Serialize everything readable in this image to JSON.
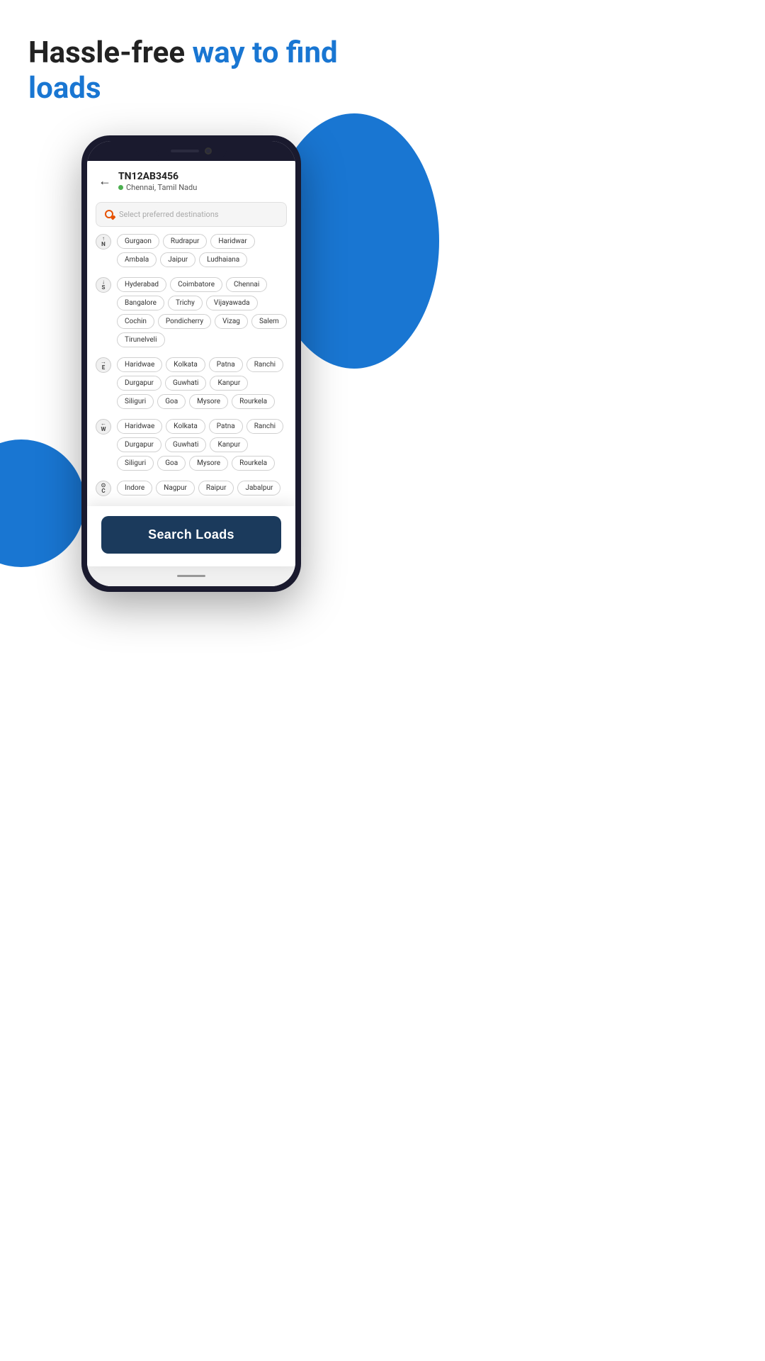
{
  "hero": {
    "line1_black": "Hassle-free ",
    "line1_blue": "way to find",
    "line2_blue": "loads"
  },
  "phone": {
    "truck_id": "TN12AB3456",
    "location": "Chennai, Tamil Nadu",
    "search_placeholder": "Select preferred destinations",
    "directions": [
      {
        "id": "N",
        "label": "N",
        "sublabel": "",
        "tags": [
          "Gurgaon",
          "Rudrapur",
          "Haridwar",
          "Ambala",
          "Jaipur",
          "Ludhaiana"
        ]
      },
      {
        "id": "S",
        "label": "S",
        "sublabel": "",
        "tags": [
          "Hyderabad",
          "Coimbatore",
          "Chennai",
          "Bangalore",
          "Trichy",
          "Vijayawada",
          "Cochin",
          "Pondicherry",
          "Vizag",
          "Salem",
          "Tirunelveli"
        ]
      },
      {
        "id": "E",
        "label": "E",
        "sublabel": "",
        "tags": [
          "Haridwae",
          "Kolkata",
          "Patna",
          "Ranchi",
          "Durgapur",
          "Guwhati",
          "Kanpur",
          "Siliguri",
          "Goa",
          "Mysore",
          "Rourkela"
        ]
      },
      {
        "id": "W",
        "label": "W",
        "sublabel": "",
        "tags": [
          "Haridwae",
          "Kolkata",
          "Patna",
          "Ranchi",
          "Durgapur",
          "Guwhati",
          "Kanpur",
          "Siliguri",
          "Goa",
          "Mysore",
          "Rourkela"
        ]
      },
      {
        "id": "C",
        "label": "C",
        "sublabel": "",
        "tags": [
          "Indore",
          "Nagpur",
          "Raipur",
          "Jabalpur"
        ]
      }
    ],
    "search_button_label": "Search Loads"
  }
}
